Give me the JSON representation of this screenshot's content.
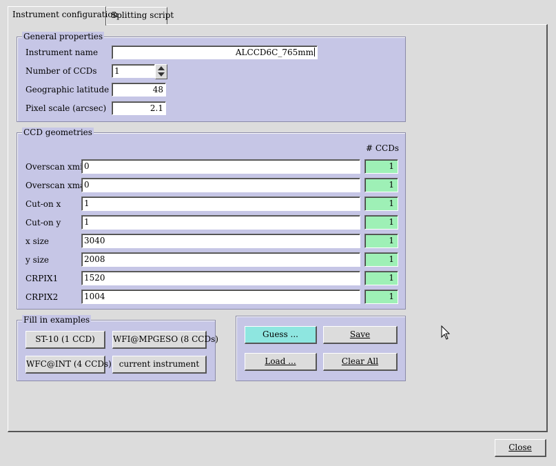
{
  "tabs": [
    {
      "label": "Instrument configuration",
      "active": true
    },
    {
      "label": "Splitting script",
      "active": false
    }
  ],
  "general": {
    "title": "General properties",
    "instrument_name_label": "Instrument name",
    "instrument_name_value": "ALCCD6C_765mm",
    "num_ccds_label": "Number of CCDs",
    "num_ccds_value": "1",
    "latitude_label": "Geographic latitude",
    "latitude_value": "48",
    "pixel_scale_label": "Pixel scale (arcsec)",
    "pixel_scale_value": "2.1"
  },
  "ccd": {
    "title": "CCD geometries",
    "count_header": "# CCDs",
    "rows": [
      {
        "label": "Overscan xmin",
        "value": "0",
        "count": "1"
      },
      {
        "label": "Overscan xmax",
        "value": "0",
        "count": "1"
      },
      {
        "label": "Cut-on x",
        "value": "1",
        "count": "1"
      },
      {
        "label": "Cut-on y",
        "value": "1",
        "count": "1"
      },
      {
        "label": "x size",
        "value": "3040",
        "count": "1"
      },
      {
        "label": "y size",
        "value": "2008",
        "count": "1"
      },
      {
        "label": "CRPIX1",
        "value": "1520",
        "count": "1"
      },
      {
        "label": "CRPIX2",
        "value": "1004",
        "count": "1"
      }
    ]
  },
  "examples": {
    "title": "Fill in examples",
    "buttons": [
      "ST-10 (1 CCD)",
      "WFI@MPGESO (8 CCDs)",
      "WFC@INT (4 CCDs)",
      "current instrument"
    ]
  },
  "actions": {
    "guess": "Guess ...",
    "save": "Save",
    "load": "Load ...",
    "clear_all": "Clear All"
  },
  "footer": {
    "close": "Close"
  },
  "colors": {
    "group_bg": "#c6c6e6",
    "count_bg": "#9ef0b6",
    "guess_bg": "#8ee6e0",
    "window_bg": "#dcdcdc"
  }
}
